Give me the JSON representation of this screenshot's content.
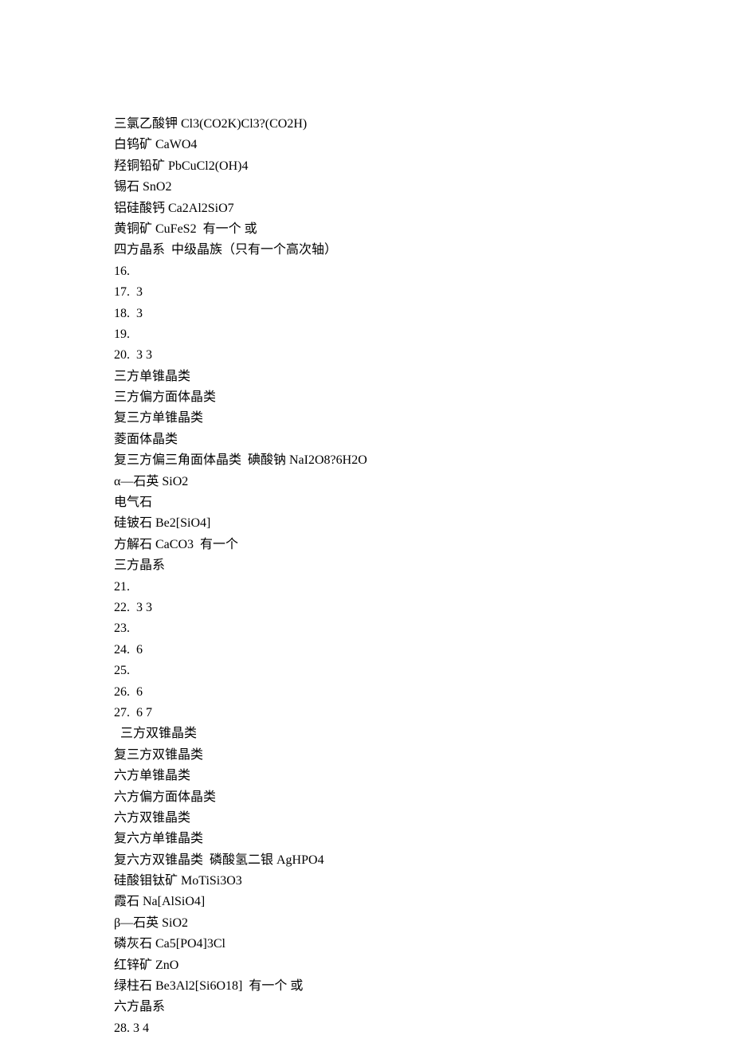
{
  "lines": [
    "三氯乙酸钾 Cl3(CO2K)Cl3?(CO2H)",
    "白钨矿 CaWO4",
    "羟铜铅矿 PbCuCl2(OH)4",
    "锡石 SnO2",
    "铝硅酸钙 Ca2Al2SiO7",
    "黄铜矿 CuFeS2  有一个 或",
    "四方晶系  中级晶族（只有一个高次轴）",
    "16.",
    "17.  3",
    "18.  3",
    "19.",
    "20.  3 3",
    "三方单锥晶类",
    "三方偏方面体晶类",
    "复三方单锥晶类",
    "菱面体晶类",
    "复三方偏三角面体晶类  碘酸钠 NaI2O8?6H2O",
    "α—石英 SiO2",
    "电气石",
    "硅铍石 Be2[SiO4]",
    "方解石 CaCO3  有一个",
    "三方晶系",
    "21.",
    "22.  3 3",
    "23.",
    "24.  6",
    "25.",
    "26.  6",
    "27.  6 7",
    "  三方双锥晶类",
    "复三方双锥晶类",
    "六方单锥晶类",
    "六方偏方面体晶类",
    "六方双锥晶类",
    "复六方单锥晶类",
    "复六方双锥晶类  磷酸氢二银 AgHPO4",
    "硅酸钼钛矿 MoTiSi3O3",
    "霞石 Na[AlSiO4]",
    "β—石英 SiO2",
    "磷灰石 Ca5[PO4]3Cl",
    "红锌矿 ZnO",
    "绿柱石 Be3Al2[Si6O18]  有一个 或",
    "六方晶系",
    "28. 3 4"
  ]
}
